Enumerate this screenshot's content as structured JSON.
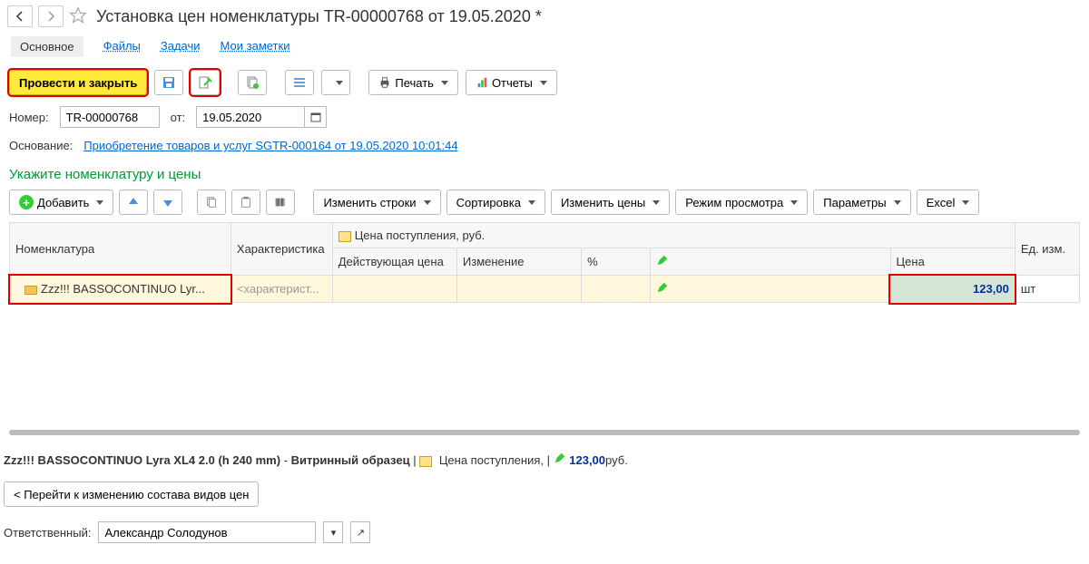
{
  "header": {
    "title": "Установка цен номенклатуры TR-00000768 от 19.05.2020 *"
  },
  "tabs": {
    "main": "Основное",
    "files": "Файлы",
    "tasks": "Задачи",
    "notes": "Мои заметки"
  },
  "toolbar": {
    "post_close": "Провести и закрыть",
    "print": "Печать",
    "reports": "Отчеты"
  },
  "fields": {
    "number_label": "Номер:",
    "number_value": "TR-00000768",
    "from_label": "от:",
    "date_value": "19.05.2020",
    "basis_label": "Основание:",
    "basis_link": "Приобретение товаров и услуг SGTR-000164 от 19.05.2020 10:01:44"
  },
  "section_title": "Укажите номенклатуру и цены",
  "toolbar2": {
    "add": "Добавить",
    "edit_rows": "Изменить строки",
    "sort": "Сортировка",
    "edit_prices": "Изменить цены",
    "view_mode": "Режим просмотра",
    "params": "Параметры",
    "excel": "Excel"
  },
  "table": {
    "headers": {
      "nomenclature": "Номенклатура",
      "characteristic": "Характеристика",
      "price_in": "Цена поступления, руб.",
      "current_price": "Действующая цена",
      "change": "Изменение",
      "percent": "%",
      "price": "Цена",
      "unit": "Ед. изм."
    },
    "row": {
      "nomenclature": "Zzz!!! BASSOCONTINUO Lyr...",
      "characteristic": "<характерист...",
      "price": "123,00",
      "unit": "шт"
    }
  },
  "summary": {
    "item_name": "Zzz!!! BASSOCONTINUO Lyra XL4 2.0 (h 240 mm)",
    "sample": "Витринный образец",
    "price_label": "Цена поступления,",
    "price_value": "123,00",
    "currency": "руб."
  },
  "bottom": {
    "change_types": "< Перейти к изменению состава видов цен",
    "responsible_label": "Ответственный:",
    "responsible_value": "Александр Солодунов"
  }
}
